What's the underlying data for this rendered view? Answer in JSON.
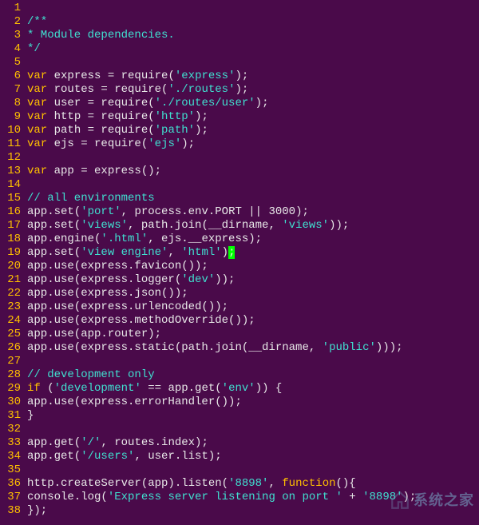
{
  "watermark_text": "系统之家",
  "lines": [
    {
      "n": 1,
      "tokens": []
    },
    {
      "n": 2,
      "tokens": [
        {
          "c": "cmt",
          "t": "/**"
        }
      ]
    },
    {
      "n": 3,
      "tokens": [
        {
          "c": "cmt",
          "t": " * Module dependencies."
        }
      ]
    },
    {
      "n": 4,
      "tokens": [
        {
          "c": "cmt",
          "t": " */"
        }
      ]
    },
    {
      "n": 5,
      "tokens": []
    },
    {
      "n": 6,
      "tokens": [
        {
          "c": "kw",
          "t": "var"
        },
        {
          "c": "op",
          "t": " express = require("
        },
        {
          "c": "str",
          "t": "'express'"
        },
        {
          "c": "op",
          "t": ");"
        }
      ]
    },
    {
      "n": 7,
      "tokens": [
        {
          "c": "kw",
          "t": "var"
        },
        {
          "c": "op",
          "t": " routes = require("
        },
        {
          "c": "str",
          "t": "'./routes'"
        },
        {
          "c": "op",
          "t": ");"
        }
      ]
    },
    {
      "n": 8,
      "tokens": [
        {
          "c": "kw",
          "t": "var"
        },
        {
          "c": "op",
          "t": " user = require("
        },
        {
          "c": "str",
          "t": "'./routes/user'"
        },
        {
          "c": "op",
          "t": ");"
        }
      ]
    },
    {
      "n": 9,
      "tokens": [
        {
          "c": "kw",
          "t": "var"
        },
        {
          "c": "op",
          "t": " http = require("
        },
        {
          "c": "str",
          "t": "'http'"
        },
        {
          "c": "op",
          "t": ");"
        }
      ]
    },
    {
      "n": 10,
      "tokens": [
        {
          "c": "kw",
          "t": "var"
        },
        {
          "c": "op",
          "t": " path = require("
        },
        {
          "c": "str",
          "t": "'path'"
        },
        {
          "c": "op",
          "t": ");"
        }
      ]
    },
    {
      "n": 11,
      "tokens": [
        {
          "c": "kw",
          "t": "var"
        },
        {
          "c": "op",
          "t": " ejs = require("
        },
        {
          "c": "str",
          "t": "'ejs'"
        },
        {
          "c": "op",
          "t": ");"
        }
      ]
    },
    {
      "n": 12,
      "tokens": []
    },
    {
      "n": 13,
      "tokens": [
        {
          "c": "kw",
          "t": "var"
        },
        {
          "c": "op",
          "t": " app = express();"
        }
      ]
    },
    {
      "n": 14,
      "tokens": []
    },
    {
      "n": 15,
      "tokens": [
        {
          "c": "cmt",
          "t": "// all environments"
        }
      ]
    },
    {
      "n": 16,
      "tokens": [
        {
          "c": "op",
          "t": "app.set("
        },
        {
          "c": "str",
          "t": "'port'"
        },
        {
          "c": "op",
          "t": ", process.env.PORT || 3000);"
        }
      ]
    },
    {
      "n": 17,
      "tokens": [
        {
          "c": "op",
          "t": "app.set("
        },
        {
          "c": "str",
          "t": "'views'"
        },
        {
          "c": "op",
          "t": ", path.join(__dirname, "
        },
        {
          "c": "str",
          "t": "'views'"
        },
        {
          "c": "op",
          "t": "));"
        }
      ]
    },
    {
      "n": 18,
      "tokens": [
        {
          "c": "op",
          "t": "app.engine("
        },
        {
          "c": "str",
          "t": "'.html'"
        },
        {
          "c": "op",
          "t": ", ejs.__express);"
        }
      ]
    },
    {
      "n": 19,
      "tokens": [
        {
          "c": "op",
          "t": "app.set("
        },
        {
          "c": "str",
          "t": "'view engine'"
        },
        {
          "c": "op",
          "t": ", "
        },
        {
          "c": "str",
          "t": "'html'"
        },
        {
          "c": "op",
          "t": ")"
        },
        {
          "c": "cursor",
          "t": ";"
        }
      ]
    },
    {
      "n": 20,
      "tokens": [
        {
          "c": "op",
          "t": "app.use(express.favicon());"
        }
      ]
    },
    {
      "n": 21,
      "tokens": [
        {
          "c": "op",
          "t": "app.use(express.logger("
        },
        {
          "c": "str",
          "t": "'dev'"
        },
        {
          "c": "op",
          "t": "));"
        }
      ]
    },
    {
      "n": 22,
      "tokens": [
        {
          "c": "op",
          "t": "app.use(express.json());"
        }
      ]
    },
    {
      "n": 23,
      "tokens": [
        {
          "c": "op",
          "t": "app.use(express.urlencoded());"
        }
      ]
    },
    {
      "n": 24,
      "tokens": [
        {
          "c": "op",
          "t": "app.use(express.methodOverride());"
        }
      ]
    },
    {
      "n": 25,
      "tokens": [
        {
          "c": "op",
          "t": "app.use(app.router);"
        }
      ]
    },
    {
      "n": 26,
      "tokens": [
        {
          "c": "op",
          "t": "app.use(express.static(path.join(__dirname, "
        },
        {
          "c": "str",
          "t": "'public'"
        },
        {
          "c": "op",
          "t": ")));"
        }
      ]
    },
    {
      "n": 27,
      "tokens": []
    },
    {
      "n": 28,
      "tokens": [
        {
          "c": "cmt",
          "t": "// development only"
        }
      ]
    },
    {
      "n": 29,
      "tokens": [
        {
          "c": "kw",
          "t": "if"
        },
        {
          "c": "op",
          "t": " ("
        },
        {
          "c": "str",
          "t": "'development'"
        },
        {
          "c": "op",
          "t": " == app.get("
        },
        {
          "c": "str",
          "t": "'env'"
        },
        {
          "c": "op",
          "t": ")) {"
        }
      ]
    },
    {
      "n": 30,
      "tokens": [
        {
          "c": "op",
          "t": "  app.use(express.errorHandler());"
        }
      ]
    },
    {
      "n": 31,
      "tokens": [
        {
          "c": "op",
          "t": "}"
        }
      ]
    },
    {
      "n": 32,
      "tokens": []
    },
    {
      "n": 33,
      "tokens": [
        {
          "c": "op",
          "t": "app.get("
        },
        {
          "c": "str",
          "t": "'/'"
        },
        {
          "c": "op",
          "t": ", routes.index);"
        }
      ]
    },
    {
      "n": 34,
      "tokens": [
        {
          "c": "op",
          "t": "app.get("
        },
        {
          "c": "str",
          "t": "'/users'"
        },
        {
          "c": "op",
          "t": ", user.list);"
        }
      ]
    },
    {
      "n": 35,
      "tokens": []
    },
    {
      "n": 36,
      "tokens": [
        {
          "c": "op",
          "t": "http.createServer(app).listen("
        },
        {
          "c": "str",
          "t": "'8898'"
        },
        {
          "c": "op",
          "t": ", "
        },
        {
          "c": "kw",
          "t": "function"
        },
        {
          "c": "op",
          "t": "(){"
        }
      ]
    },
    {
      "n": 37,
      "tokens": [
        {
          "c": "op",
          "t": "  console.log("
        },
        {
          "c": "str",
          "t": "'Express server listening on port '"
        },
        {
          "c": "op",
          "t": " + "
        },
        {
          "c": "str",
          "t": "'8898'"
        },
        {
          "c": "op",
          "t": ");"
        }
      ]
    },
    {
      "n": 38,
      "tokens": [
        {
          "c": "op",
          "t": "});"
        }
      ]
    }
  ]
}
